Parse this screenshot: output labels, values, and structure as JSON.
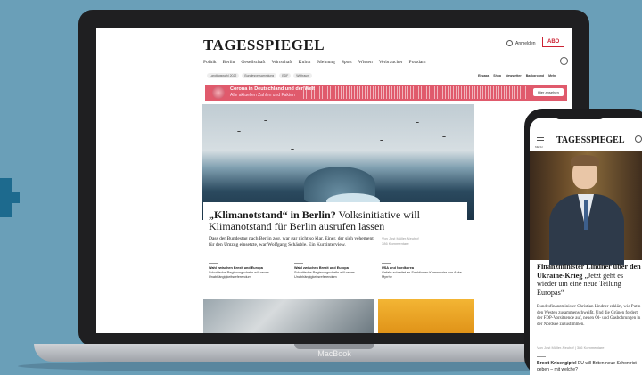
{
  "laptop": {
    "brand": "MacBook"
  },
  "site": {
    "logo": "TAGESSPIEGEL",
    "account_label": "Anmelden",
    "abo_label": "ABO",
    "nav": [
      "Politik",
      "Berlin",
      "Gesellschaft",
      "Wirtschaft",
      "Kultur",
      "Meinung",
      "Sport",
      "Wissen",
      "Verbraucher",
      "Potsdam"
    ],
    "pills": [
      "Landtagswahl 2022",
      "Bundesversammlung",
      "EDF",
      "Weltraum"
    ],
    "right_links": [
      "Eilsaga",
      "Shop",
      "Newsletter",
      "Background",
      "Mehr"
    ],
    "banner": {
      "title": "Corona in Deutschland und der Welt",
      "subtitle": "Alle aktuellen Zahlen und Fakten",
      "button": "Hier ansehen"
    },
    "headline_bold": "„Klimanotstand“ in Berlin?",
    "headline_rest": " Volksinitiative will Klimanotstand für Berlin ausrufen lassen",
    "teaser": "Dass der Bundestag nach Berlin zog, war gar nicht so klar. Einer, der sich vehement für den Umzug einsetzte, war Wolfgang Schäuble. Ein Kurzinterview.",
    "meta_author": "Von Jost Müller-Neuhof",
    "meta_comments": "386 Kommentare",
    "columns": [
      {
        "title": "Wahl zwischen Brexit und Europa",
        "text": "Schottische Regierungschefin will neues Unabhängigkeitsreferendum"
      },
      {
        "title": "Wahl zwischen Brexit und Europa",
        "text": "Schottische Regierungschefin will neues Unabhängigkeitsreferendum"
      },
      {
        "title": "USA und Nordkorea",
        "text": "Gefahr schreitet an Sanktionen Kommentar von Anke Myrrhe"
      }
    ]
  },
  "phone": {
    "logo": "TAGESSPIEGEL",
    "menu_label": "MENU",
    "title_bold": "Finanzminister Lindner über den Ukraine-Krieg",
    "title_rest": " „Jetzt geht es wieder um eine neue Teilung Europas“",
    "text": "Bundesfinanzminister Christian Lindner erklärt, wie Putin den Westen zusammenschweißt. Und die Grünen fordert der FDP-Vorsitzende auf, neuen Öl- und Gasbohrungen in der Nordsee zuzustimmen.",
    "meta": "Von Jost Müller-Neuhof  |  386 Kommentare",
    "next_bold": "Brexit Krisengipfel",
    "next_rest": " EU will Briten neue Schonfrist geben – mit welche?"
  }
}
